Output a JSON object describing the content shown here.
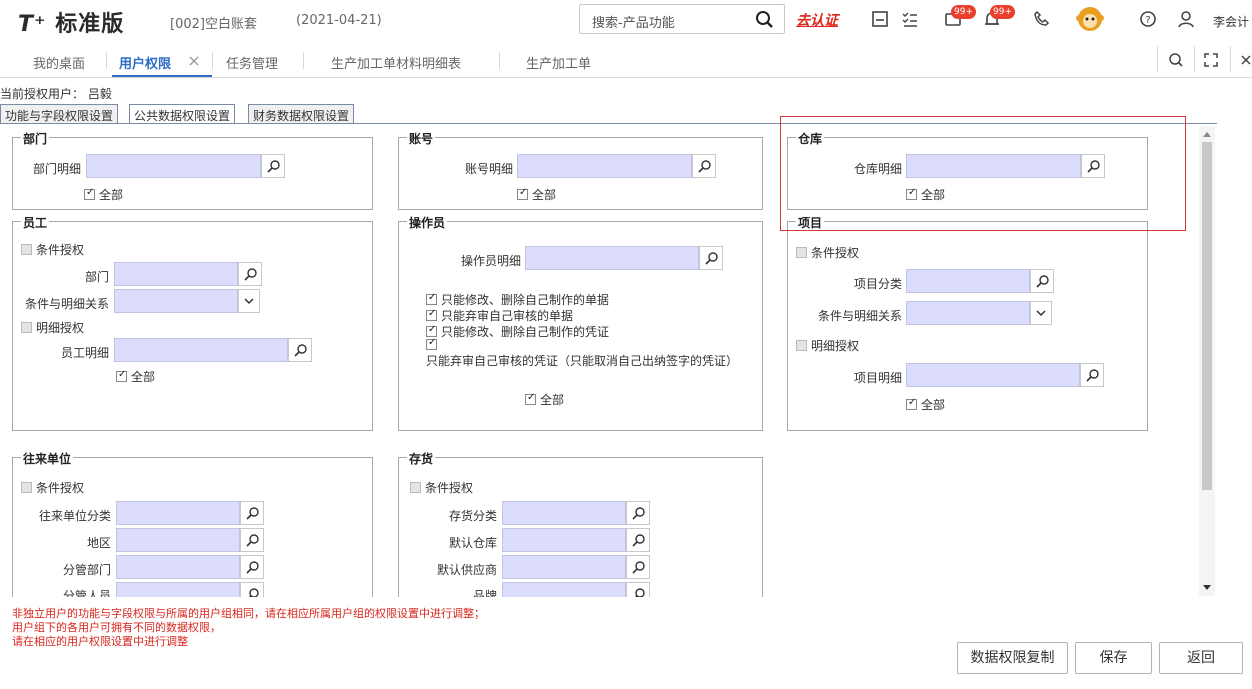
{
  "header": {
    "logo_prefix": "T⁺",
    "logo_text": "标准版",
    "account": "[002]空白账套",
    "date": "(2021-04-21)",
    "search_placeholder": "搜索-产品功能",
    "cert_link": "去认证",
    "badge_messages": "99+",
    "badge_notifications": "99+",
    "user_name": "李会计"
  },
  "tabs": [
    {
      "label": "我的桌面"
    },
    {
      "label": "用户权限"
    },
    {
      "label": "任务管理"
    },
    {
      "label": "生产加工单材料明细表"
    },
    {
      "label": "生产加工单"
    }
  ],
  "current_user": "当前授权用户： 吕毅",
  "subtabs": [
    {
      "label": "功能与字段权限设置"
    },
    {
      "label": "公共数据权限设置"
    },
    {
      "label": "财务数据权限设置"
    }
  ],
  "groups": {
    "dept": {
      "title": "部门",
      "detail_label": "部门明细",
      "all": "全部"
    },
    "account": {
      "title": "账号",
      "detail_label": "账号明细",
      "all": "全部"
    },
    "warehouse": {
      "title": "仓库",
      "detail_label": "仓库明细",
      "all": "全部"
    },
    "employee": {
      "title": "员工",
      "cond_auth": "条件授权",
      "dept_label": "部门",
      "relation_label": "条件与明细关系",
      "detail_auth": "明细授权",
      "detail_label": "员工明细",
      "all": "全部"
    },
    "operator": {
      "title": "操作员",
      "detail_label": "操作员明细",
      "opt1": "只能修改、删除自己制作的单据",
      "opt2": "只能弃审自己审核的单据",
      "opt3": "只能修改、删除自己制作的凭证",
      "opt4": "只能弃审自己审核的凭证（只能取消自己出纳签字的凭证）",
      "all": "全部"
    },
    "project": {
      "title": "项目",
      "cond_auth": "条件授权",
      "category_label": "项目分类",
      "relation_label": "条件与明细关系",
      "detail_auth": "明细授权",
      "detail_label": "项目明细",
      "all": "全部"
    },
    "partner": {
      "title": "往来单位",
      "cond_auth": "条件授权",
      "category_label": "往来单位分类",
      "region_label": "地区",
      "dept_label": "分管部门",
      "person_label": "分管人员"
    },
    "inventory": {
      "title": "存货",
      "cond_auth": "条件授权",
      "category_label": "存货分类",
      "warehouse_label": "默认仓库",
      "supplier_label": "默认供应商",
      "brand_label": "品牌"
    }
  },
  "notes": [
    "非独立用户的功能与字段权限与所属的用户组相同，请在相应所属用户组的权限设置中进行调整；",
    "用户组下的各用户可拥有不同的数据权限，",
    "请在相应的用户权限设置中进行调整"
  ],
  "buttons": {
    "copy": "数据权限复制",
    "save": "保存",
    "back": "返回"
  }
}
